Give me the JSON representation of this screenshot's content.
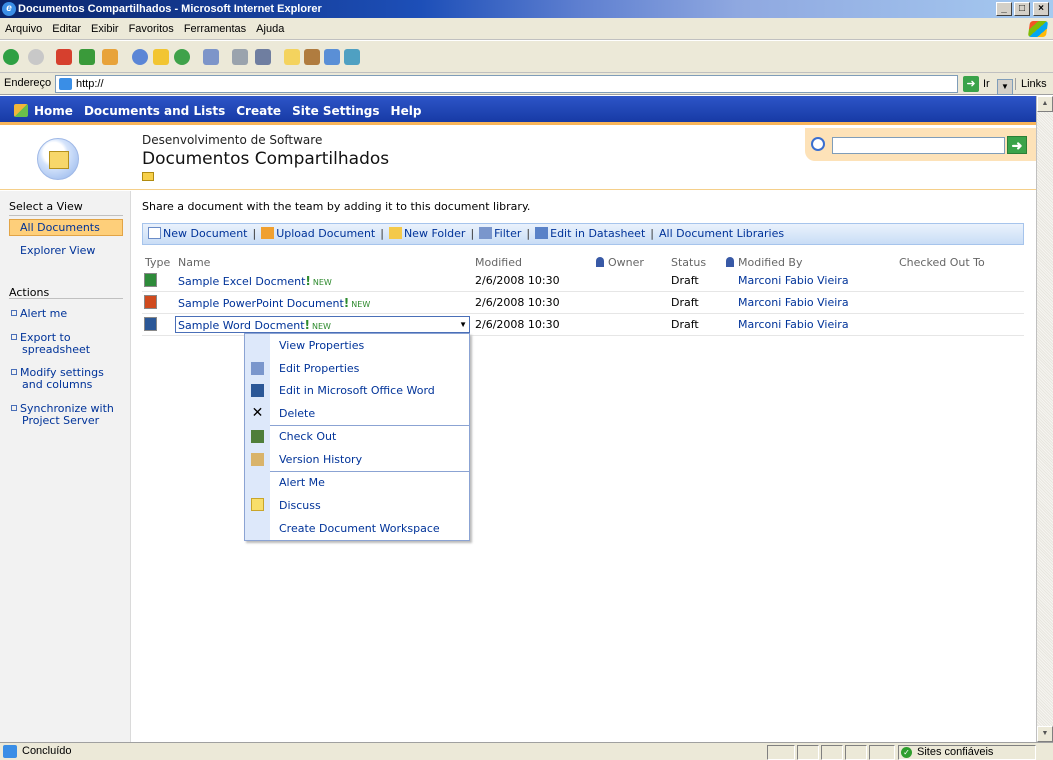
{
  "window": {
    "title": "Documentos Compartilhados - Microsoft Internet Explorer"
  },
  "menubar": [
    "Arquivo",
    "Editar",
    "Exibir",
    "Favoritos",
    "Ferramentas",
    "Ajuda"
  ],
  "addressbar": {
    "label": "Endereço",
    "url": "http://",
    "go_label": "Ir",
    "links_label": "Links"
  },
  "sharepoint": {
    "topnav": [
      "Home",
      "Documents and Lists",
      "Create",
      "Site Settings",
      "Help"
    ],
    "site_name": "Desenvolvimento de Software",
    "page_title": "Documentos Compartilhados",
    "search_placeholder": ""
  },
  "leftnav": {
    "select_view_heading": "Select a View",
    "views": [
      "All Documents",
      "Explorer View"
    ],
    "actions_heading": "Actions",
    "actions": [
      {
        "line1": "Alert me",
        "line2": ""
      },
      {
        "line1": "Export to",
        "line2": "spreadsheet"
      },
      {
        "line1": "Modify settings",
        "line2": "and columns"
      },
      {
        "line1": "Synchronize with",
        "line2": "Project Server"
      }
    ]
  },
  "content": {
    "description": "Share a document with the team by adding it to this document library.",
    "toolbar": [
      "New Document",
      "Upload Document",
      "New Folder",
      "Filter",
      "Edit in Datasheet",
      "All Document Libraries"
    ],
    "columns": [
      "Type",
      "Name",
      "Modified",
      "Owner",
      "Status",
      "Modified By",
      "Checked Out To"
    ],
    "rows": [
      {
        "name": "Sample Excel Docment",
        "badge": "NEW",
        "modified": "2/6/2008 10:30",
        "status": "Draft",
        "modified_by": "Marconi Fabio Vieira",
        "icon": "excel-icon",
        "color": "#2e8b3a"
      },
      {
        "name": "Sample PowerPoint Document",
        "badge": "NEW",
        "modified": "2/6/2008 10:30",
        "status": "Draft",
        "modified_by": "Marconi Fabio Vieira",
        "icon": "powerpoint-icon",
        "color": "#d04a1e"
      },
      {
        "name": "Sample Word Docment",
        "badge": "NEW",
        "modified": "2/6/2008 10:30",
        "status": "Draft",
        "modified_by": "Marconi Fabio Vieira",
        "icon": "word-icon",
        "color": "#2b5797"
      }
    ]
  },
  "context_menu": [
    "View Properties",
    "Edit Properties",
    "Edit in Microsoft Office Word",
    "Delete",
    "Check Out",
    "Version History",
    "Alert Me",
    "Discuss",
    "Create Document Workspace"
  ],
  "statusbar": {
    "status": "Concluído",
    "zone": "Sites confiáveis"
  }
}
